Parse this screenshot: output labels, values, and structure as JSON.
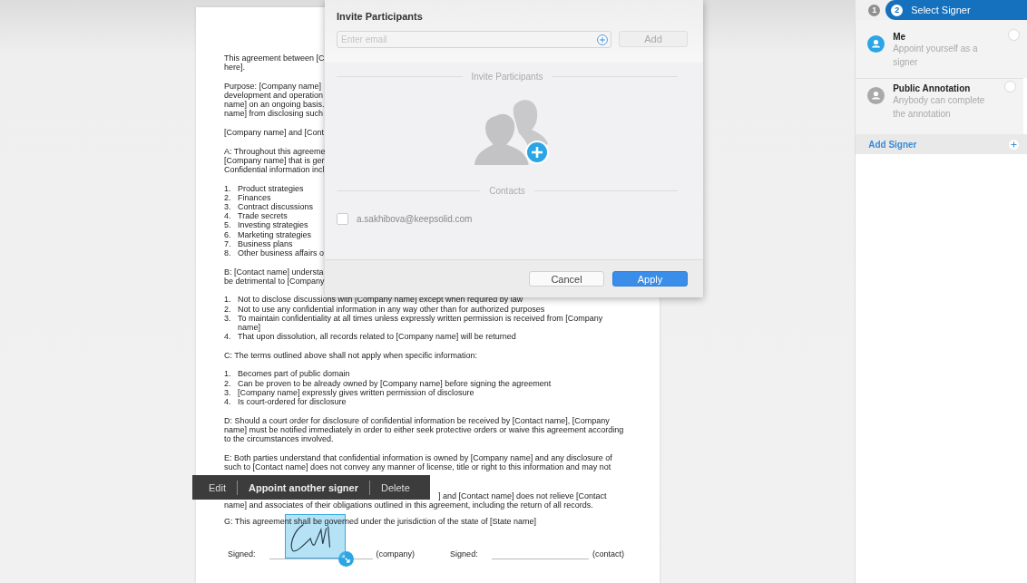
{
  "document": {
    "paragraphs": [
      {
        "kind": "text",
        "lines": [
          "This agreement between [C",
          "here]."
        ]
      },
      {
        "kind": "text",
        "lines": [
          "Purpose: [Company name]",
          "development and operation",
          "name] on an ongoing basis.",
          "name] from disclosing such"
        ]
      },
      {
        "kind": "text",
        "lines": [
          "[Company name] and [Cont"
        ]
      },
      {
        "kind": "text",
        "lines": [
          "A: Throughout this agreeme",
          "[Company name] that is ger",
          "Confidential information incl"
        ]
      },
      {
        "kind": "list",
        "items": [
          {
            "number": "1.",
            "lines": [
              "Product strategies"
            ]
          },
          {
            "number": "2.",
            "lines": [
              "Finances"
            ]
          },
          {
            "number": "3.",
            "lines": [
              "Contract discussions"
            ]
          },
          {
            "number": "4.",
            "lines": [
              "Trade secrets"
            ]
          },
          {
            "number": "5.",
            "lines": [
              "Investing strategies"
            ]
          },
          {
            "number": "6.",
            "lines": [
              "Marketing strategies"
            ]
          },
          {
            "number": "7.",
            "lines": [
              "Business plans"
            ]
          },
          {
            "number": "8.",
            "lines": [
              "Other business affairs o"
            ]
          }
        ]
      },
      {
        "kind": "text",
        "lines": [
          "B: [Contact name] understa",
          "be detrimental to [Company"
        ]
      },
      {
        "kind": "list",
        "items": [
          {
            "number": "1.",
            "lines": [
              "Not to disclose discussions with [Company name] except when required by law"
            ]
          },
          {
            "number": "2.",
            "lines": [
              "Not to use any confidential information in any way other than for authorized purposes"
            ]
          },
          {
            "number": "3.",
            "lines": [
              "To maintain confidentiality at all times unless expressly written permission is received from [Company",
              "name]"
            ]
          },
          {
            "number": "4.",
            "lines": [
              "That upon dissolution, all records related to [Company name] will be returned"
            ]
          }
        ]
      },
      {
        "kind": "text",
        "lines": [
          "C: The terms outlined above shall not apply when specific information:"
        ]
      },
      {
        "kind": "list",
        "items": [
          {
            "number": "1.",
            "lines": [
              "Becomes part of public domain"
            ]
          },
          {
            "number": "2.",
            "lines": [
              "Can be proven to be already owned by [Company name] before signing the agreement"
            ]
          },
          {
            "number": "3.",
            "lines": [
              "[Company name] expressly gives written permission of disclosure"
            ]
          },
          {
            "number": "4.",
            "lines": [
              "Is court-ordered for disclosure"
            ]
          }
        ]
      },
      {
        "kind": "text",
        "lines": [
          "D: Should a court order for disclosure of confidential information be received by [Contact name], [Company",
          "name] must be notified immediately in order to either seek protective orders or waive this agreement according",
          "to the circumstances involved."
        ]
      },
      {
        "kind": "text",
        "lines": [
          "E: Both parties understand that confidential information is owned by [Company name] and any disclosure of",
          "such to [Contact name] does not convey any manner of license, title or right to this information and may not"
        ]
      },
      {
        "kind": "covered",
        "lines": [
          "] and [Contact name] does not relieve [Contact",
          "name] and associates of their obligations outlined in this agreement, including the return of all records."
        ]
      },
      {
        "kind": "text",
        "lines": [
          "G: This agreement shall be governed under the jurisdiction of the state of [State name]"
        ]
      }
    ],
    "signatures": [
      {
        "label": "Signed:",
        "role": "(company)"
      },
      {
        "label": "Signed:",
        "role": "(contact)"
      }
    ]
  },
  "toolbar": {
    "buttons": [
      {
        "label": "Edit",
        "primary": false
      },
      {
        "label": "Appoint another signer",
        "primary": true
      },
      {
        "label": "Delete",
        "primary": false
      }
    ]
  },
  "dialog": {
    "title": "Invite Participants",
    "email_field": {
      "placeholder": "Enter email"
    },
    "add_button": "Add",
    "section_title": "Invite Participants",
    "contacts_title": "Contacts",
    "contacts": [
      {
        "email": "a.sakhibova@keepsolid.com",
        "checked": false
      }
    ],
    "buttons": [
      {
        "label": "Cancel",
        "kind": "secondary"
      },
      {
        "label": "Apply",
        "kind": "primary"
      }
    ]
  },
  "signer_panel": {
    "steps": [
      {
        "number": "1",
        "selected": false
      },
      {
        "number": "2",
        "label": "Select Signer",
        "selected": true
      }
    ],
    "signers": [
      {
        "name": "Me",
        "description": [
          "Appoint yourself as a",
          "signer"
        ],
        "color": "#2aa6e6",
        "selected": false
      },
      {
        "name": "Public Annotation",
        "description": [
          "Anybody can complete",
          "the annotation"
        ],
        "color": "#a9a9ab",
        "selected": false
      }
    ],
    "add_signer": "Add Signer"
  }
}
